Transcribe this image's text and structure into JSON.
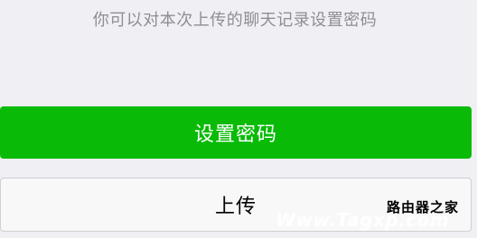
{
  "hint": {
    "text": "你可以对本次上传的聊天记录设置密码"
  },
  "buttons": {
    "set_password": "设置密码",
    "upload": "上传"
  },
  "watermark": {
    "site_name": "路由器之家",
    "url": "Www.Tagxp.com"
  },
  "colors": {
    "primary_green": "#09bb07",
    "background": "#efeff4",
    "hint_text": "#8e8e93"
  }
}
